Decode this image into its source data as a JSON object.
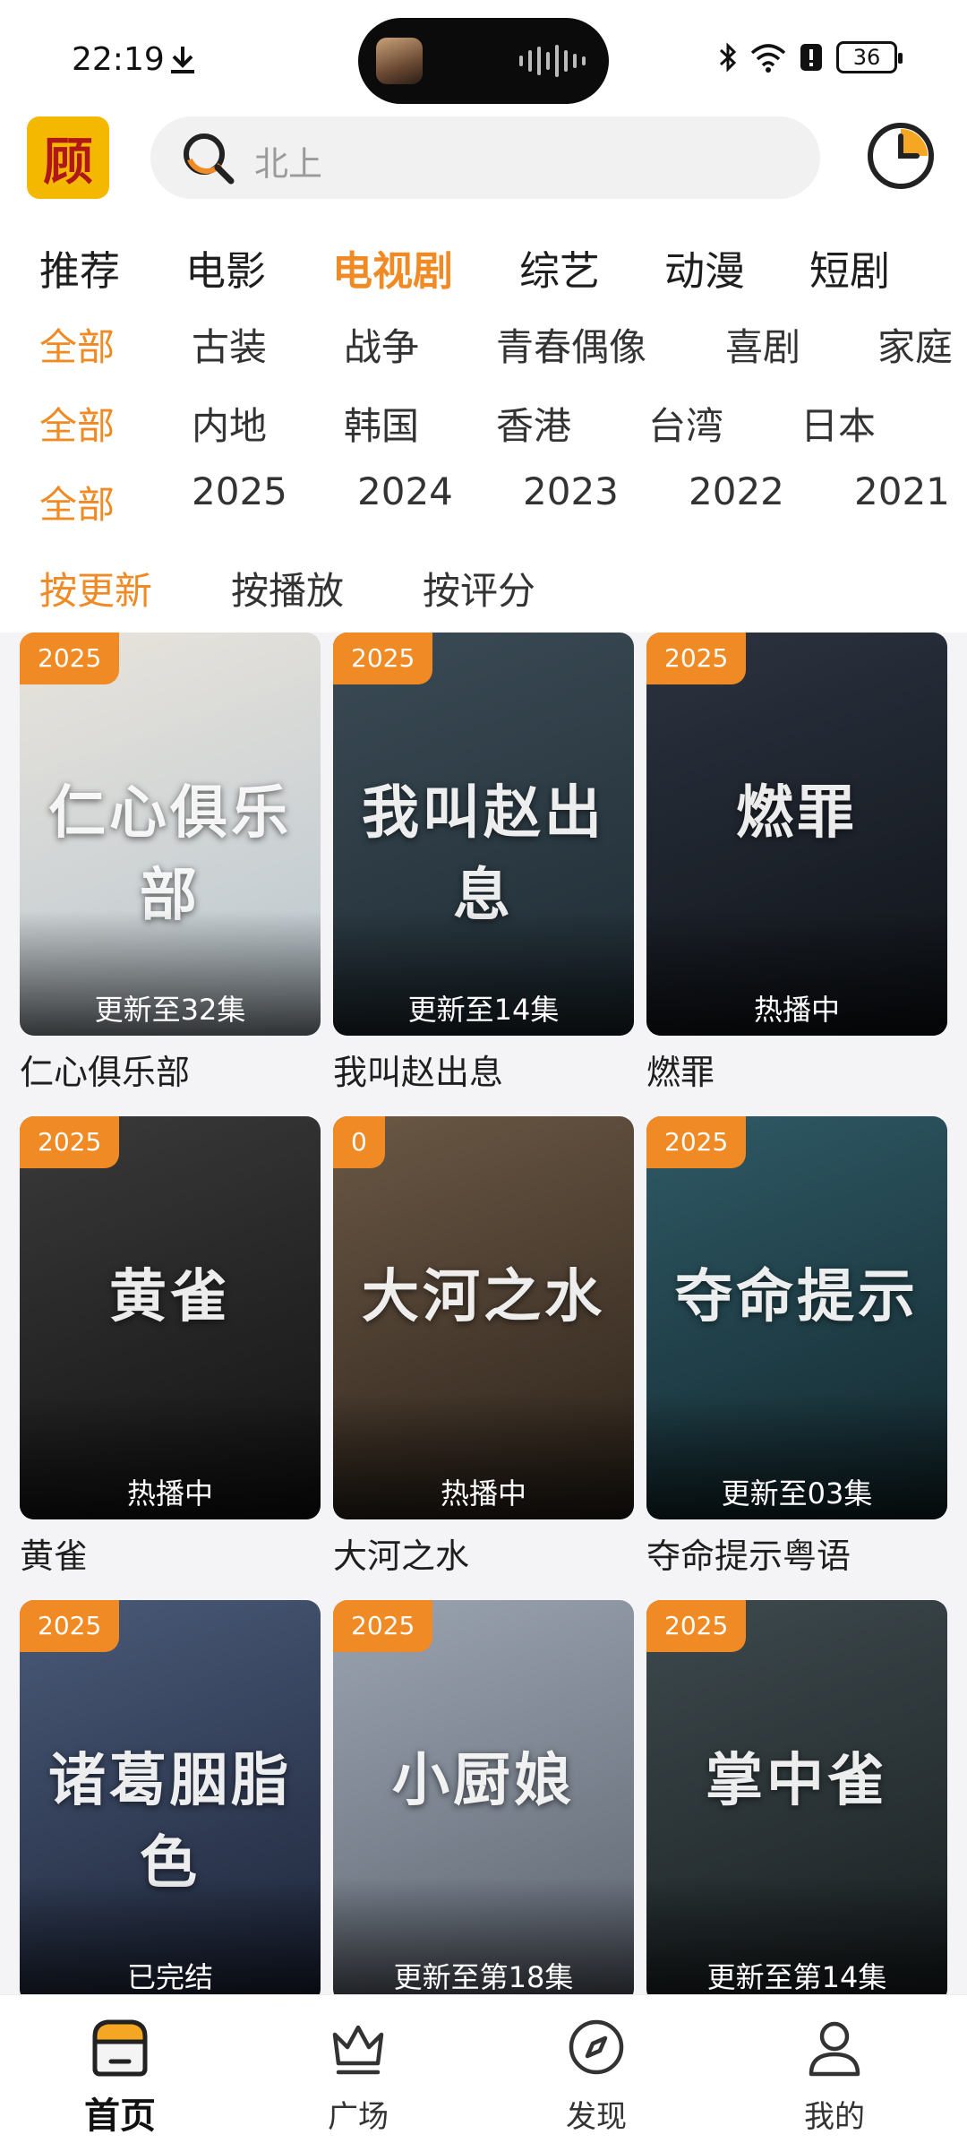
{
  "status": {
    "time": "22:19",
    "battery": "36"
  },
  "search": {
    "placeholder": "北上"
  },
  "logo": {
    "text": "顾"
  },
  "tabs": [
    {
      "label": "推荐"
    },
    {
      "label": "电影"
    },
    {
      "label": "电视剧",
      "active": true
    },
    {
      "label": "综艺"
    },
    {
      "label": "动漫"
    },
    {
      "label": "短剧"
    }
  ],
  "filters": {
    "genre": [
      "全部",
      "古装",
      "战争",
      "青春偶像",
      "喜剧",
      "家庭"
    ],
    "region": [
      "全部",
      "内地",
      "韩国",
      "香港",
      "台湾",
      "日本"
    ],
    "year": [
      "全部",
      "2025",
      "2024",
      "2023",
      "2022",
      "2021"
    ],
    "sort": [
      "按更新",
      "按播放",
      "按评分"
    ]
  },
  "cards": [
    {
      "title": "仁心俱乐部",
      "badge": "2025",
      "episode": "更新至32集",
      "poster_text": "仁心俱乐部",
      "colors": [
        "#e9e4dc",
        "#b9c6cf"
      ]
    },
    {
      "title": "我叫赵出息",
      "badge": "2025",
      "episode": "更新至14集",
      "poster_text": "我叫赵出息",
      "colors": [
        "#3b4b55",
        "#1e2b33"
      ]
    },
    {
      "title": "燃罪",
      "badge": "2025",
      "episode": "热播中",
      "poster_text": "燃罪",
      "colors": [
        "#2c3340",
        "#0f1318"
      ]
    },
    {
      "title": "黄雀",
      "badge": "2025",
      "episode": "热播中",
      "poster_text": "黄雀",
      "colors": [
        "#3a3a3a",
        "#121212"
      ]
    },
    {
      "title": "大河之水",
      "badge": "0",
      "episode": "热播中",
      "poster_text": "大河之水",
      "colors": [
        "#6b5845",
        "#2a2119"
      ]
    },
    {
      "title": "夺命提示粤语",
      "badge": "2025",
      "episode": "更新至03集",
      "poster_text": "夺命提示",
      "colors": [
        "#2f5a66",
        "#12262c"
      ]
    },
    {
      "title": "",
      "badge": "2025",
      "episode": "已完结",
      "poster_text": "诸葛胭脂色",
      "colors": [
        "#4a5a78",
        "#1c2438"
      ]
    },
    {
      "title": "",
      "badge": "2025",
      "episode": "更新至第18集",
      "poster_text": "小厨娘",
      "colors": [
        "#9aa4b0",
        "#5d6470"
      ]
    },
    {
      "title": "",
      "badge": "2025",
      "episode": "更新至第14集",
      "poster_text": "掌中雀",
      "colors": [
        "#3e4a4e",
        "#181e20"
      ]
    }
  ],
  "nav": [
    {
      "label": "首页",
      "icon": "home-icon",
      "active": true
    },
    {
      "label": "广场",
      "icon": "crown-icon"
    },
    {
      "label": "发现",
      "icon": "compass-icon"
    },
    {
      "label": "我的",
      "icon": "user-icon"
    }
  ],
  "accent": "#f08a24"
}
